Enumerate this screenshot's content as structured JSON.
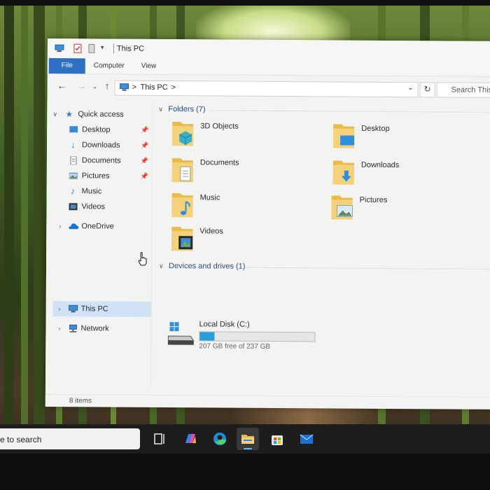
{
  "window": {
    "title": "This PC",
    "ribbon_tabs": [
      "File",
      "Computer",
      "View"
    ]
  },
  "address": {
    "path": [
      "This PC"
    ],
    "separator": ">",
    "search_placeholder": "Search This PC"
  },
  "nav": {
    "quick_access": "Quick access",
    "quick_items": [
      {
        "label": "Desktop",
        "icon": "desktop-icon",
        "pinned": true
      },
      {
        "label": "Downloads",
        "icon": "downloads-icon",
        "pinned": true
      },
      {
        "label": "Documents",
        "icon": "documents-icon",
        "pinned": true
      },
      {
        "label": "Pictures",
        "icon": "pictures-icon",
        "pinned": true
      },
      {
        "label": "Music",
        "icon": "music-icon",
        "pinned": false
      },
      {
        "label": "Videos",
        "icon": "videos-icon",
        "pinned": false
      }
    ],
    "onedrive": "OneDrive",
    "this_pc": "This PC",
    "network": "Network"
  },
  "content": {
    "folders_header": "Folders (7)",
    "folders": [
      {
        "label": "3D Objects",
        "icon": "3d-objects-folder-icon"
      },
      {
        "label": "Desktop",
        "icon": "desktop-folder-icon"
      },
      {
        "label": "Documents",
        "icon": "documents-folder-icon"
      },
      {
        "label": "Downloads",
        "icon": "downloads-folder-icon"
      },
      {
        "label": "Music",
        "icon": "music-folder-icon"
      },
      {
        "label": "Pictures",
        "icon": "pictures-folder-icon"
      },
      {
        "label": "Videos",
        "icon": "videos-folder-icon"
      }
    ],
    "drives_header": "Devices and drives (1)",
    "drive": {
      "name": "Local Disk (C:)",
      "free_text": "207 GB free of 237 GB",
      "used_fraction": 0.127
    }
  },
  "status": {
    "items": "8 items"
  },
  "taskbar": {
    "search_text": "e to search",
    "apps": [
      "task-view-icon",
      "copilot-icon",
      "edge-icon",
      "file-explorer-icon",
      "store-icon",
      "mail-icon"
    ]
  },
  "colors": {
    "accent": "#2e6fc4",
    "selection": "#cfe2f6",
    "drive_bar": "#26a0da",
    "folder": "#e8bb4a"
  }
}
